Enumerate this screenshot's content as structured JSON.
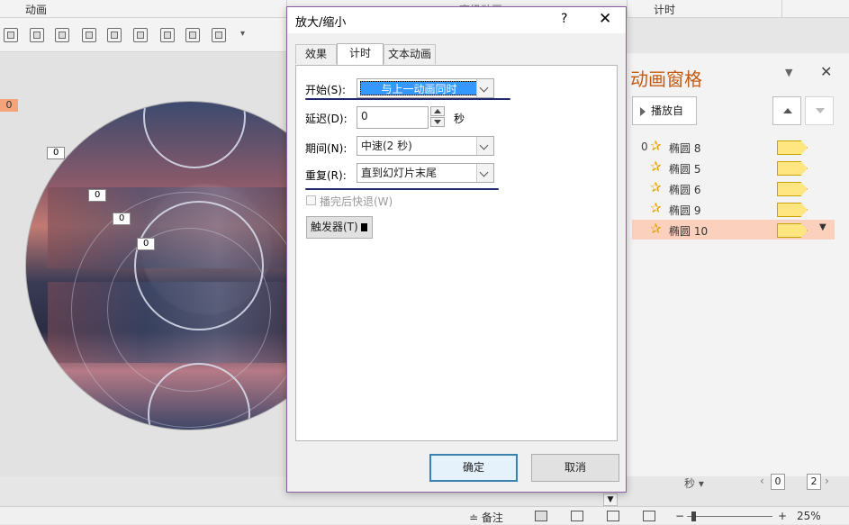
{
  "ribbon": {
    "tab_animation": "动画",
    "tab_advanced_animation": "高级动画",
    "tab_timing": "计时"
  },
  "slide": {
    "slide_number_badge": "0",
    "animation_tags": [
      "0",
      "0",
      "0",
      "0"
    ]
  },
  "animation_pane": {
    "title": "动画窗格",
    "play_button": "播放自",
    "items": [
      {
        "number": "0",
        "label": "椭圆 8",
        "selected": false
      },
      {
        "number": "",
        "label": "椭圆 5",
        "selected": false
      },
      {
        "number": "",
        "label": "椭圆 6",
        "selected": false
      },
      {
        "number": "",
        "label": "椭圆 9",
        "selected": false
      },
      {
        "number": "",
        "label": "椭圆 10",
        "selected": true
      }
    ],
    "seconds_label": "秒",
    "pager_start": "0",
    "pager_end": "2"
  },
  "dialog": {
    "title": "放大/缩小",
    "help": "?",
    "close": "✕",
    "tabs": [
      "效果",
      "计时",
      "文本动画"
    ],
    "active_tab": "计时",
    "start_label": "开始(S):",
    "start_value": "与上一动画同时",
    "delay_label": "延迟(D):",
    "delay_value": "0",
    "delay_unit": "秒",
    "duration_label": "期间(N):",
    "duration_value": "中速(2 秒)",
    "repeat_label": "重复(R):",
    "repeat_value": "直到幻灯片末尾",
    "rewind_label": "播完后快退(W)",
    "trigger_label": "触发器(T)",
    "ok": "确定",
    "cancel": "取消"
  },
  "statusbar": {
    "notes": "备注",
    "zoom": "25%",
    "zoom_fraction": 0.25
  },
  "colors": {
    "pane_title": "#c55a11",
    "selected_row": "#fbd0bd",
    "start_highlight": "#3399ff",
    "dialog_border": "#8e5ea5",
    "annotation_line": "#1f2a6d"
  }
}
